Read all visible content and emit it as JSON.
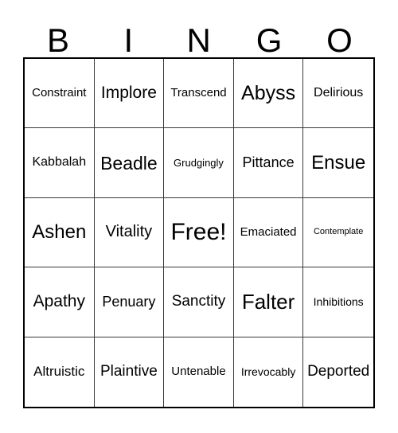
{
  "card": {
    "header_letters": [
      "B",
      "I",
      "N",
      "G",
      "O"
    ],
    "rows": [
      [
        {
          "text": "Constraint",
          "font_size": 15
        },
        {
          "text": "Implore",
          "font_size": 21
        },
        {
          "text": "Transcend",
          "font_size": 15
        },
        {
          "text": "Abyss",
          "font_size": 25
        },
        {
          "text": "Delirious",
          "font_size": 16
        }
      ],
      [
        {
          "text": "Kabbalah",
          "font_size": 16
        },
        {
          "text": "Beadle",
          "font_size": 23
        },
        {
          "text": "Grudgingly",
          "font_size": 13
        },
        {
          "text": "Pittance",
          "font_size": 18
        },
        {
          "text": "Ensue",
          "font_size": 24
        }
      ],
      [
        {
          "text": "Ashen",
          "font_size": 24
        },
        {
          "text": "Vitality",
          "font_size": 20
        },
        {
          "text": "Free!",
          "font_size": 30
        },
        {
          "text": "Emaciated",
          "font_size": 15
        },
        {
          "text": "Contemplate",
          "font_size": 11
        }
      ],
      [
        {
          "text": "Apathy",
          "font_size": 21
        },
        {
          "text": "Penuary",
          "font_size": 18
        },
        {
          "text": "Sanctity",
          "font_size": 19
        },
        {
          "text": "Falter",
          "font_size": 26
        },
        {
          "text": "Inhibitions",
          "font_size": 14
        }
      ],
      [
        {
          "text": "Altruistic",
          "font_size": 17
        },
        {
          "text": "Plaintive",
          "font_size": 19
        },
        {
          "text": "Untenable",
          "font_size": 15
        },
        {
          "text": "Irrevocably",
          "font_size": 14
        },
        {
          "text": "Deported",
          "font_size": 19
        }
      ]
    ],
    "colors": {
      "background": "#ffffff",
      "text": "#000000",
      "outer_border": "#000000",
      "inner_border": "#3a3a3a"
    }
  }
}
